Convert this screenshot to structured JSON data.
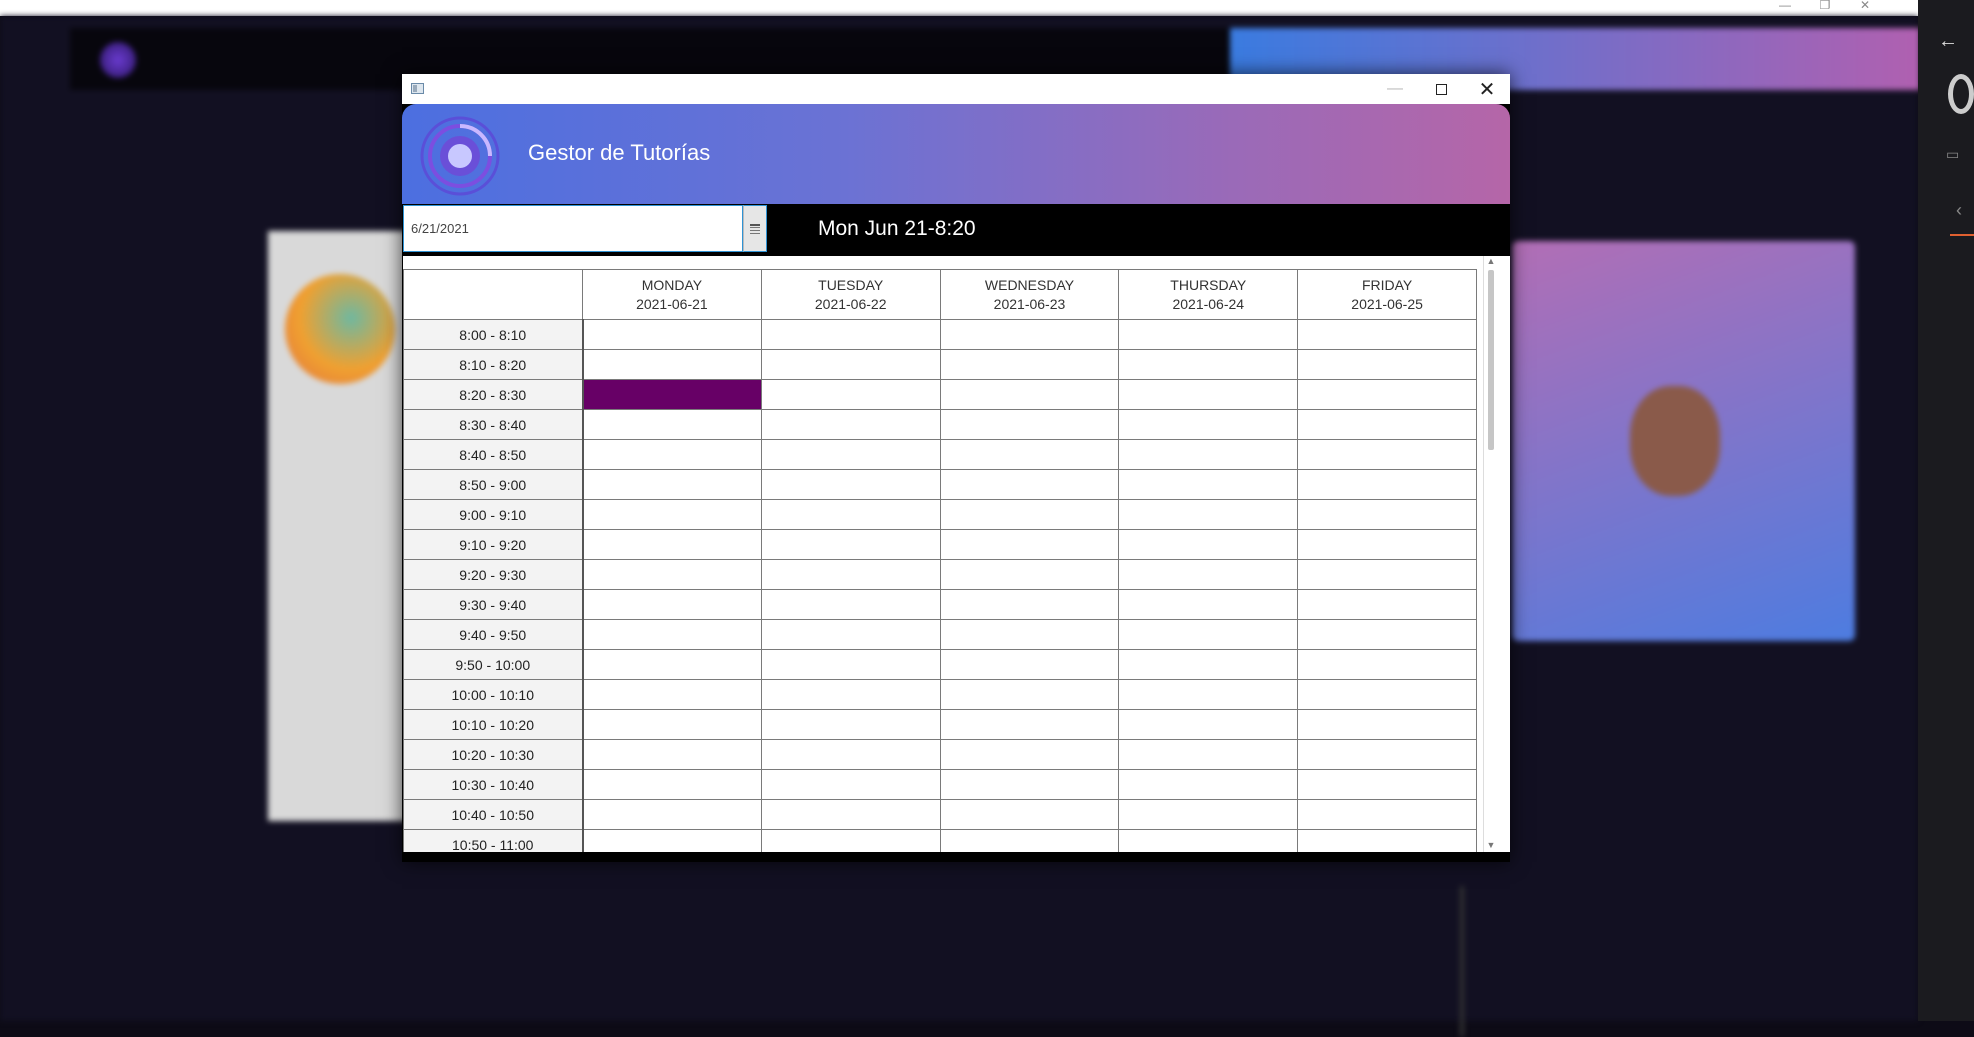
{
  "window": {
    "app_title": "Gestor de Tutorías",
    "date_value": "6/21/2021",
    "clock_text": "Mon Jun 21-8:20",
    "title_controls": {
      "minimize": "—",
      "close": "✕"
    }
  },
  "schedule": {
    "days": [
      {
        "name": "MONDAY",
        "date": "2021-06-21"
      },
      {
        "name": "TUESDAY",
        "date": "2021-06-22"
      },
      {
        "name": "WEDNESDAY",
        "date": "2021-06-23"
      },
      {
        "name": "THURSDAY",
        "date": "2021-06-24"
      },
      {
        "name": "FRIDAY",
        "date": "2021-06-25"
      }
    ],
    "slots": [
      "8:00 - 8:10",
      "8:10 - 8:20",
      "8:20 - 8:30",
      "8:30 - 8:40",
      "8:40 - 8:50",
      "8:50 - 9:00",
      "9:00 - 9:10",
      "9:10 - 9:20",
      "9:20 - 9:30",
      "9:30 - 9:40",
      "9:40 - 9:50",
      "9:50 - 10:00",
      "10:00 - 10:10",
      "10:10 - 10:20",
      "10:20 - 10:30",
      "10:30 - 10:40",
      "10:40 - 10:50",
      "10:50 - 11:00"
    ],
    "booked": [
      {
        "slot": "8:20 - 8:30",
        "day": "MONDAY",
        "color": "#670066"
      }
    ]
  },
  "colors": {
    "header_gradient_start": "#4c6fe0",
    "header_gradient_end": "#b566a8",
    "booked": "#670066",
    "input_focus": "#2f93d4"
  },
  "icons": {
    "app": "window-app-icon",
    "logo": "tutor-logo-icon",
    "calendar": "calendar-icon",
    "maximize": "maximize-icon",
    "minimize": "minimize-icon",
    "close": "close-icon"
  }
}
